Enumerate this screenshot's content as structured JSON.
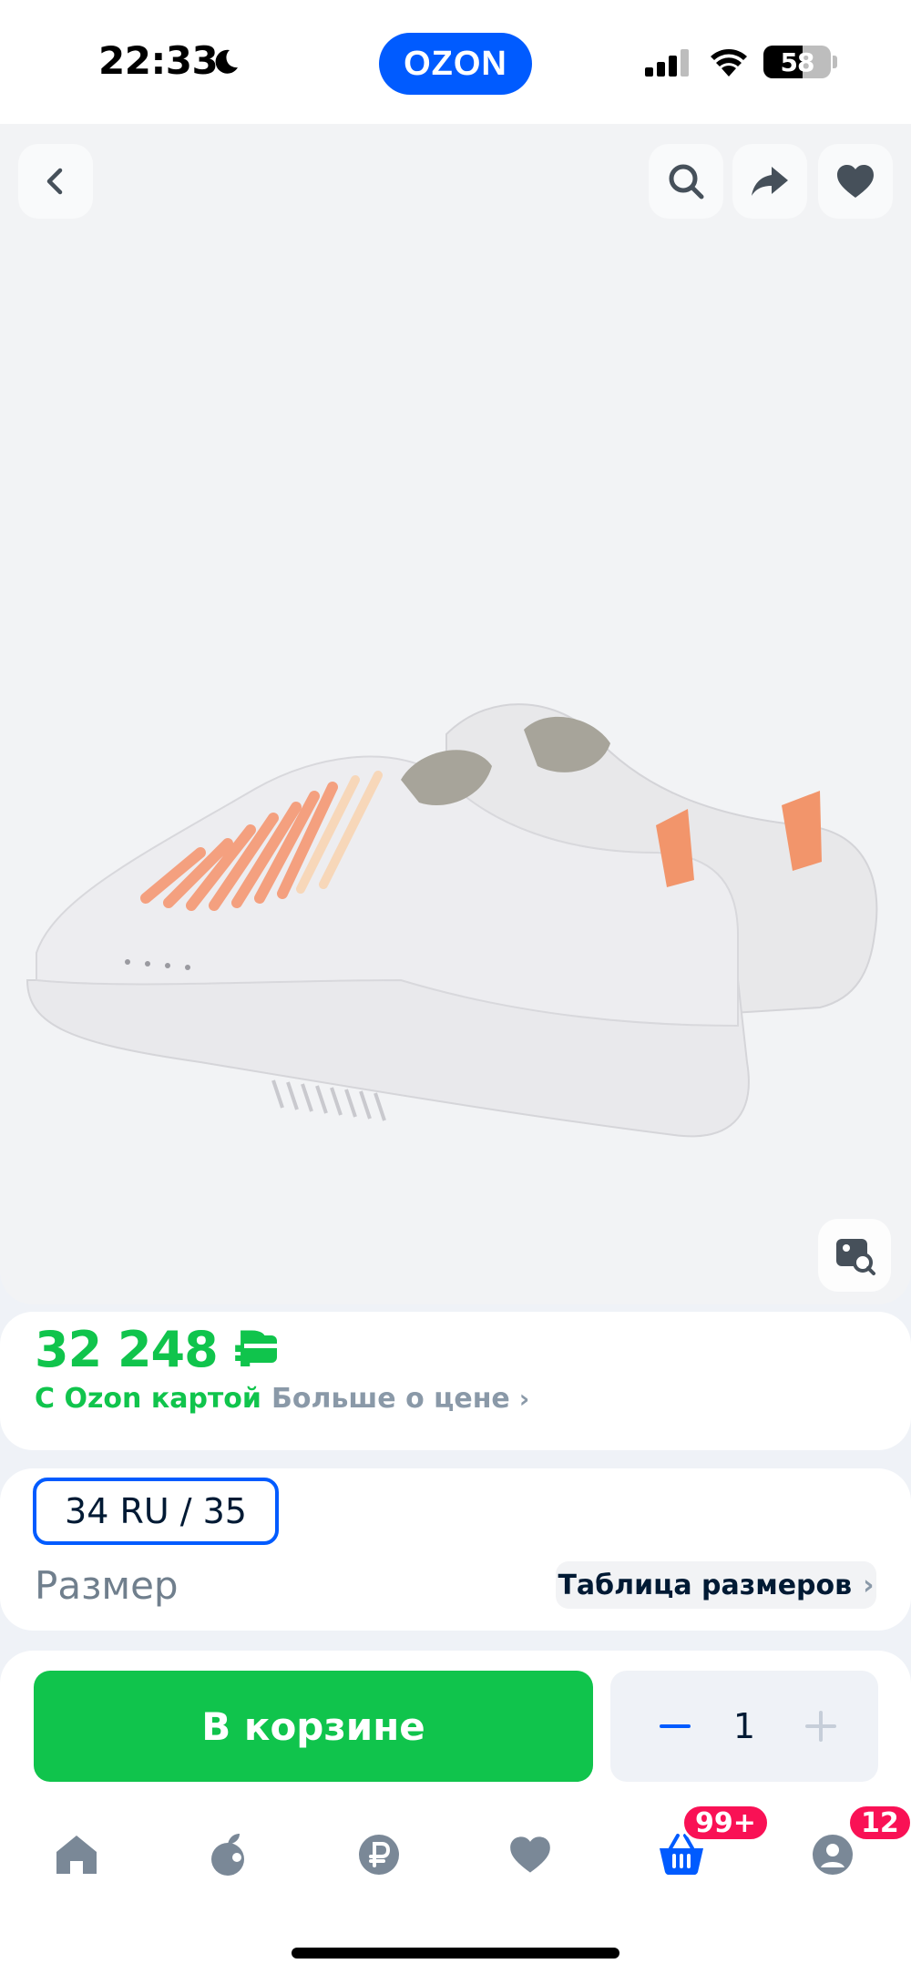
{
  "status_bar": {
    "time": "22:33",
    "battery_level": 58,
    "battery_label": "58",
    "icons": [
      "moon-icon",
      "cellular-signal-icon",
      "wifi-icon",
      "battery-icon"
    ]
  },
  "header": {
    "logo": "OZON",
    "brand_color": "#005bff"
  },
  "gallery": {
    "icons": [
      "back-arrow-icon",
      "search-icon",
      "share-icon",
      "heart-icon",
      "visual-search-icon"
    ]
  },
  "price_block": {
    "price": "32 248 ₽",
    "ozon_card_label": "С Ozon картой",
    "more_label": "Больше о цене",
    "accent_color": "#10c44c"
  },
  "size_block": {
    "selected_size": "34 RU / 35",
    "label": "Размер",
    "size_table_label": "Таблица размеров"
  },
  "action_bar": {
    "cart_label": "В корзине",
    "quantity": "1"
  },
  "tab_bar": {
    "tabs": [
      {
        "name": "home",
        "icon": "home-icon"
      },
      {
        "name": "fresh",
        "icon": "fresh-icon"
      },
      {
        "name": "finance",
        "icon": "ruble-icon"
      },
      {
        "name": "favorites",
        "icon": "heart-icon"
      },
      {
        "name": "cart",
        "icon": "basket-icon"
      },
      {
        "name": "profile",
        "icon": "profile-icon"
      }
    ],
    "cart_badge": "99+",
    "profile_badge": "12",
    "badge_color": "#f91155"
  }
}
